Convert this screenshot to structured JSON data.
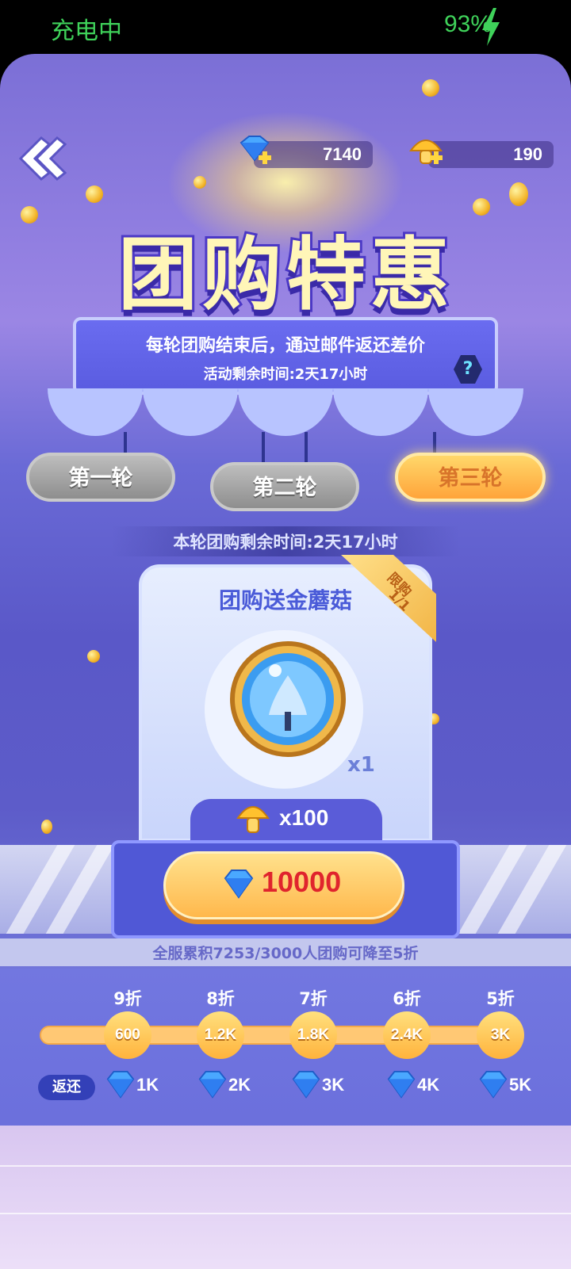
{
  "status": {
    "left_text": "充电中",
    "battery": "93%"
  },
  "currency": {
    "gems": "7140",
    "mushrooms": "190"
  },
  "title": "团购特惠",
  "info": {
    "line1": "每轮团购结束后，通过邮件返还差价",
    "line2": "活动剩余时间:2天17小时",
    "help": "?"
  },
  "tabs": [
    {
      "label": "第一轮"
    },
    {
      "label": "第二轮"
    },
    {
      "label": "第三轮"
    }
  ],
  "round_time": "本轮团购剩余时间:2天17小时",
  "card": {
    "title": "团购送金蘑菇",
    "limit_line1": "限购",
    "limit_line2": "1/1",
    "item_qty": "x1",
    "reward_qty": "x100"
  },
  "buy": {
    "price": "10000"
  },
  "progress_note": "全服累积7253/3000人团购可降至5折",
  "ladder": {
    "discounts": [
      "9折",
      "8折",
      "7折",
      "6折",
      "5折"
    ],
    "thresholds": [
      "600",
      "1.2K",
      "1.8K",
      "2.4K",
      "3K"
    ],
    "return_label": "返还",
    "returns": [
      "1K",
      "2K",
      "3K",
      "4K",
      "5K"
    ]
  },
  "colors": {
    "accent": "#ffb84c",
    "price": "#e0242d",
    "status": "#3fd25a"
  }
}
